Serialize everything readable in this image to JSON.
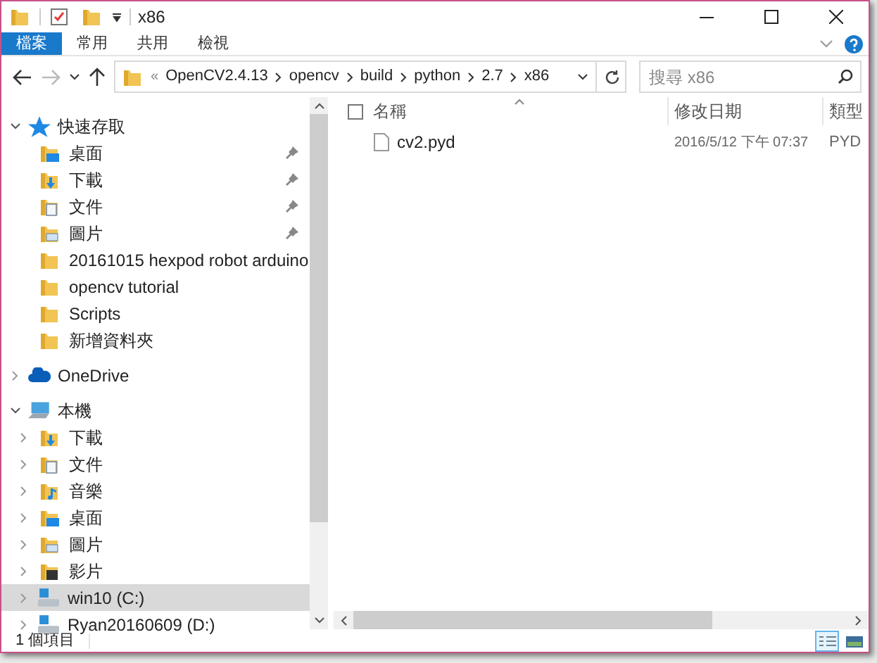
{
  "window": {
    "title": "x86"
  },
  "ribbon_tabs": [
    {
      "label": "檔案",
      "selected": true
    },
    {
      "label": "常用",
      "selected": false
    },
    {
      "label": "共用",
      "selected": false
    },
    {
      "label": "檢視",
      "selected": false
    }
  ],
  "address": {
    "overflow": "«",
    "segments": [
      "OpenCV2.4.13",
      "opencv",
      "build",
      "python",
      "2.7",
      "x86"
    ]
  },
  "search": {
    "placeholder": "搜尋 x86"
  },
  "sidebar": {
    "items": [
      {
        "label": "快速存取",
        "kind": "star",
        "expanded": true,
        "children": [
          {
            "label": "桌面",
            "kind": "desktop",
            "pinned": true
          },
          {
            "label": "下載",
            "kind": "download",
            "pinned": true
          },
          {
            "label": "文件",
            "kind": "documents",
            "pinned": true
          },
          {
            "label": "圖片",
            "kind": "pictures",
            "pinned": true
          },
          {
            "label": "20161015 hexpod robot arduino",
            "kind": "folder",
            "pinned": false
          },
          {
            "label": "opencv tutorial",
            "kind": "folder",
            "pinned": false
          },
          {
            "label": "Scripts",
            "kind": "folder",
            "pinned": false
          },
          {
            "label": "新增資料夾",
            "kind": "folder",
            "pinned": false
          }
        ]
      },
      {
        "label": "OneDrive",
        "kind": "cloud",
        "expanded": false
      },
      {
        "label": "本機",
        "kind": "computer",
        "expanded": true,
        "children": [
          {
            "label": "下載",
            "kind": "download",
            "expandable": true,
            "selected": false
          },
          {
            "label": "文件",
            "kind": "documents",
            "expandable": true,
            "selected": false
          },
          {
            "label": "音樂",
            "kind": "music",
            "expandable": true,
            "selected": false
          },
          {
            "label": "桌面",
            "kind": "desktop",
            "expandable": true,
            "selected": false
          },
          {
            "label": "圖片",
            "kind": "pictures",
            "expandable": true,
            "selected": false
          },
          {
            "label": "影片",
            "kind": "videos",
            "expandable": true,
            "selected": false
          },
          {
            "label": "win10 (C:)",
            "kind": "drive",
            "expandable": true,
            "selected": true
          },
          {
            "label": "Ryan20160609 (D:)",
            "kind": "drive",
            "expandable": true,
            "selected": false
          }
        ]
      }
    ]
  },
  "table": {
    "select_all": {
      "checked": false
    },
    "columns": [
      "名稱",
      "修改日期",
      "類型"
    ],
    "rows": [
      {
        "name": "cv2.pyd",
        "modified": "2016/5/12 下午 07:37",
        "type": "PYD",
        "selected": false
      }
    ]
  },
  "status_bar": {
    "count": "1 個項目",
    "views": [
      {
        "kind": "details",
        "selected": true
      },
      {
        "kind": "thumbnails",
        "selected": false
      }
    ]
  }
}
